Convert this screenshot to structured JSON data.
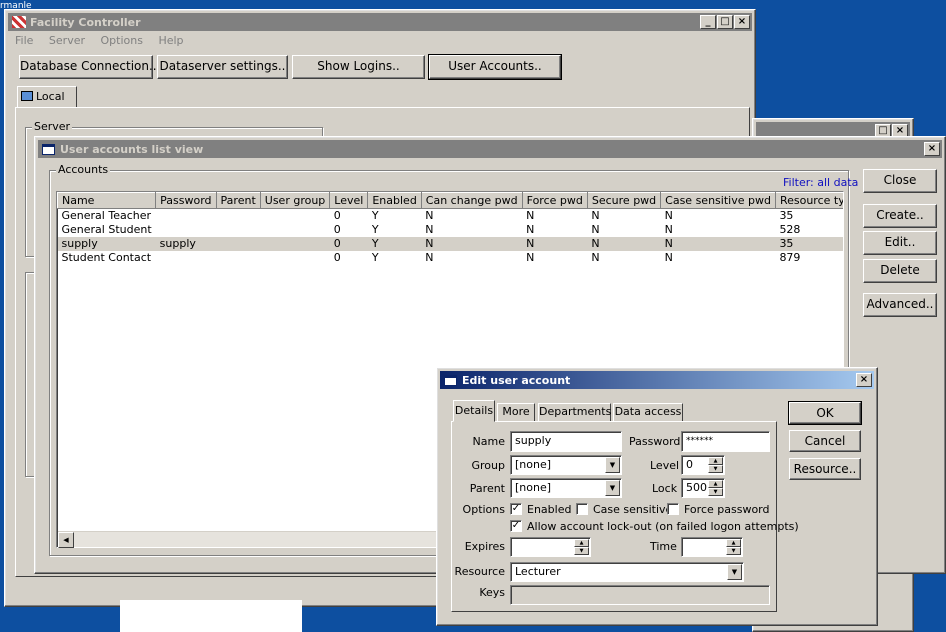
{
  "desktop": {
    "icon_text": "rmanle"
  },
  "main_window": {
    "title": "Facility Controller",
    "menu": [
      "File",
      "Server",
      "Options",
      "Help"
    ],
    "toolbar": {
      "db_connection": "Database Connection..",
      "dataserver_settings": "Dataserver settings..",
      "show_logins": "Show Logins..",
      "user_accounts": "User Accounts.."
    },
    "tab_local": "Local",
    "server_group": "Server",
    "control_buttons": {
      "minimize": "_",
      "maximize": "□",
      "close": "×"
    }
  },
  "list_window": {
    "title": "User accounts list view",
    "accounts_group": "Accounts",
    "filter": "Filter: all data",
    "columns": [
      "Name",
      "Password",
      "Parent",
      "User group",
      "Level",
      "Enabled",
      "Can change pwd",
      "Force pwd",
      "Secure pwd",
      "Case sensitive pwd",
      "Resource type"
    ],
    "rows": [
      [
        "General Teacher",
        "",
        "",
        "",
        "0",
        "Y",
        "N",
        "N",
        "N",
        "N",
        "35"
      ],
      [
        "General Student",
        "",
        "",
        "",
        "0",
        "Y",
        "N",
        "N",
        "N",
        "N",
        "528"
      ],
      [
        "supply",
        "supply",
        "",
        "",
        "0",
        "Y",
        "N",
        "N",
        "N",
        "N",
        "35"
      ],
      [
        "Student Contact",
        "",
        "",
        "",
        "0",
        "Y",
        "N",
        "N",
        "N",
        "N",
        "879"
      ]
    ],
    "selected_row": 2,
    "buttons": {
      "close": "Close",
      "create": "Create..",
      "edit": "Edit..",
      "delete": "Delete",
      "advanced": "Advanced.."
    }
  },
  "edit_dialog": {
    "title": "Edit user account",
    "tabs": [
      "Details",
      "More",
      "Departments",
      "Data access"
    ],
    "active_tab": "Details",
    "labels": {
      "name": "Name",
      "password": "Password",
      "group": "Group",
      "level": "Level",
      "parent": "Parent",
      "lock": "Lock",
      "options": "Options",
      "expires": "Expires",
      "time": "Time",
      "resource": "Resource",
      "keys": "Keys"
    },
    "values": {
      "name": "supply",
      "password": "******",
      "group": "[none]",
      "level": "0",
      "parent": "[none]",
      "lock": "500",
      "expires": "",
      "time": "",
      "resource": "Lecturer",
      "keys": ""
    },
    "options": {
      "enabled": "Enabled",
      "enabled_checked": true,
      "case_sensitive": "Case sensitive",
      "case_sensitive_checked": false,
      "force_password": "Force password",
      "force_password_checked": false,
      "lockout": "Allow account lock-out (on failed logon attempts)",
      "lockout_checked": true
    },
    "buttons": {
      "ok": "OK",
      "cancel": "Cancel",
      "resource": "Resource.."
    }
  }
}
